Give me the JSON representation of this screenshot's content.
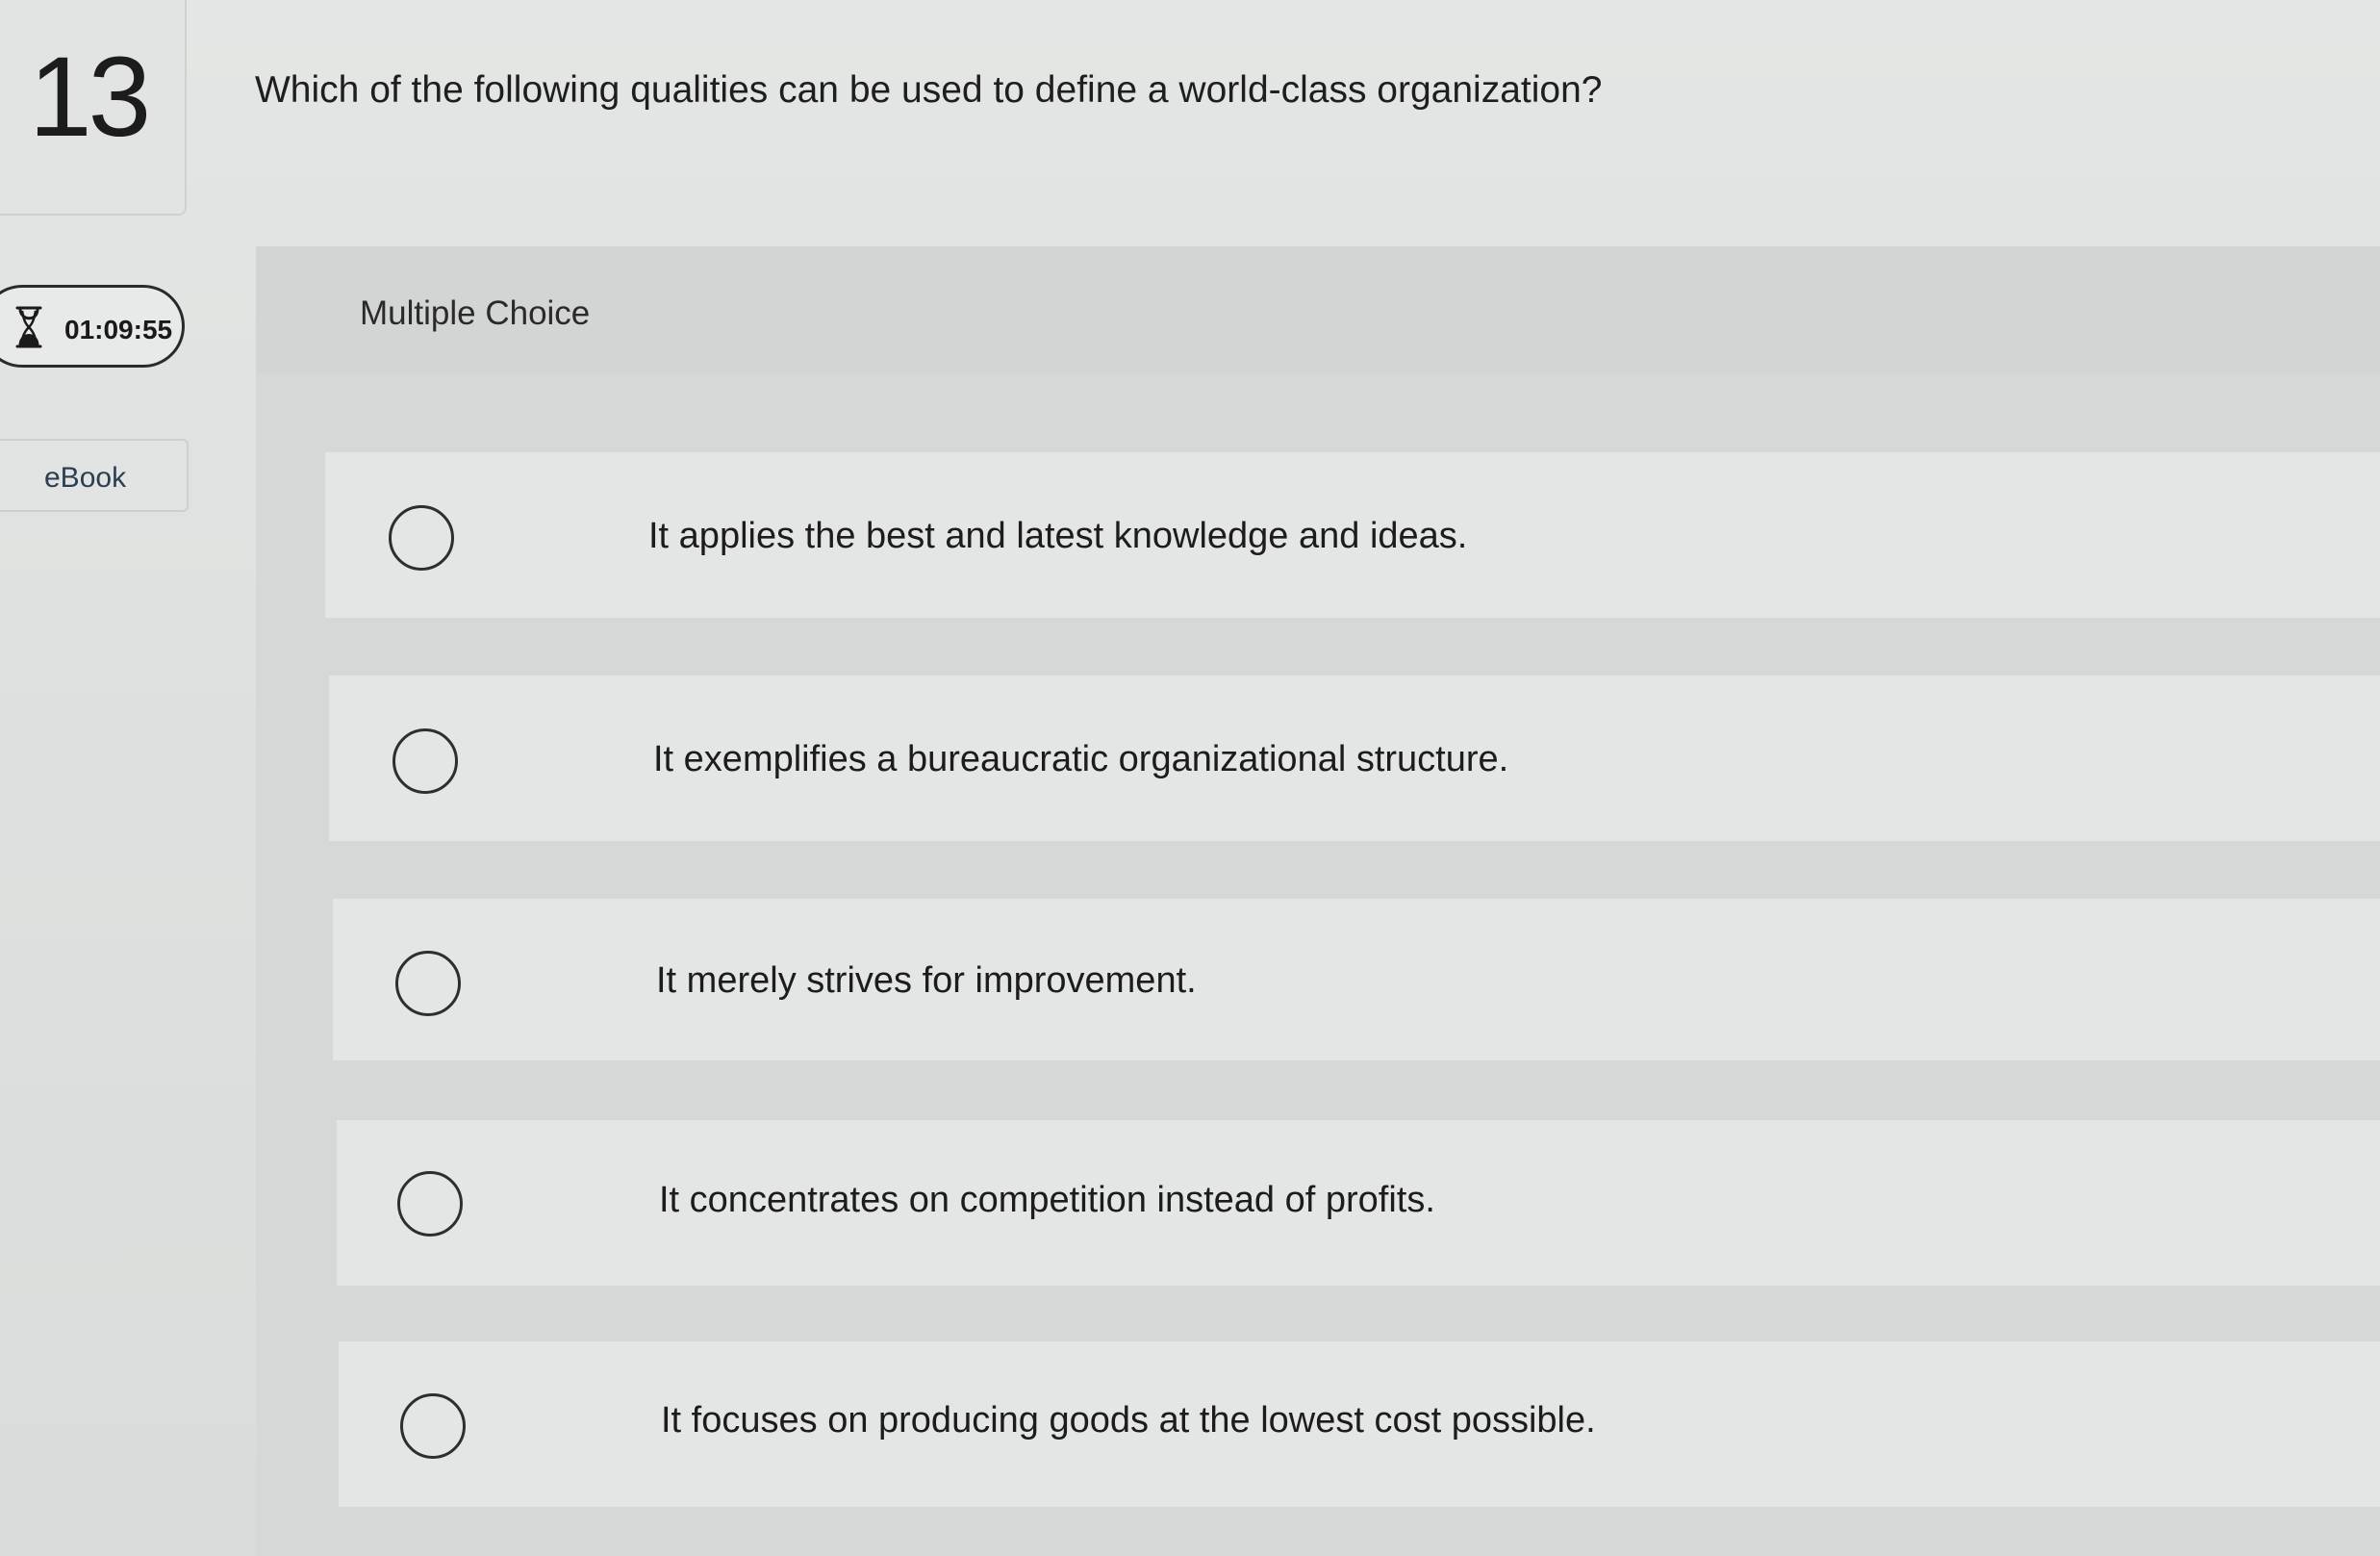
{
  "question": {
    "number": "13",
    "text": "Which of the following qualities can be used to define a world-class organization?"
  },
  "timer": {
    "icon": "hourglass-icon",
    "value": "01:09:55"
  },
  "ebook": {
    "label": "eBook"
  },
  "answer_area": {
    "type_label": "Multiple Choice",
    "options": [
      {
        "text": "It applies the best and latest knowledge and ideas.",
        "selected": false
      },
      {
        "text": "It exemplifies a bureaucratic organizational structure.",
        "selected": false
      },
      {
        "text": "It merely strives for improvement.",
        "selected": false
      },
      {
        "text": "It concentrates on competition instead of profits.",
        "selected": false
      },
      {
        "text": "It focuses on producing goods at the lowest cost possible.",
        "selected": false
      }
    ]
  }
}
